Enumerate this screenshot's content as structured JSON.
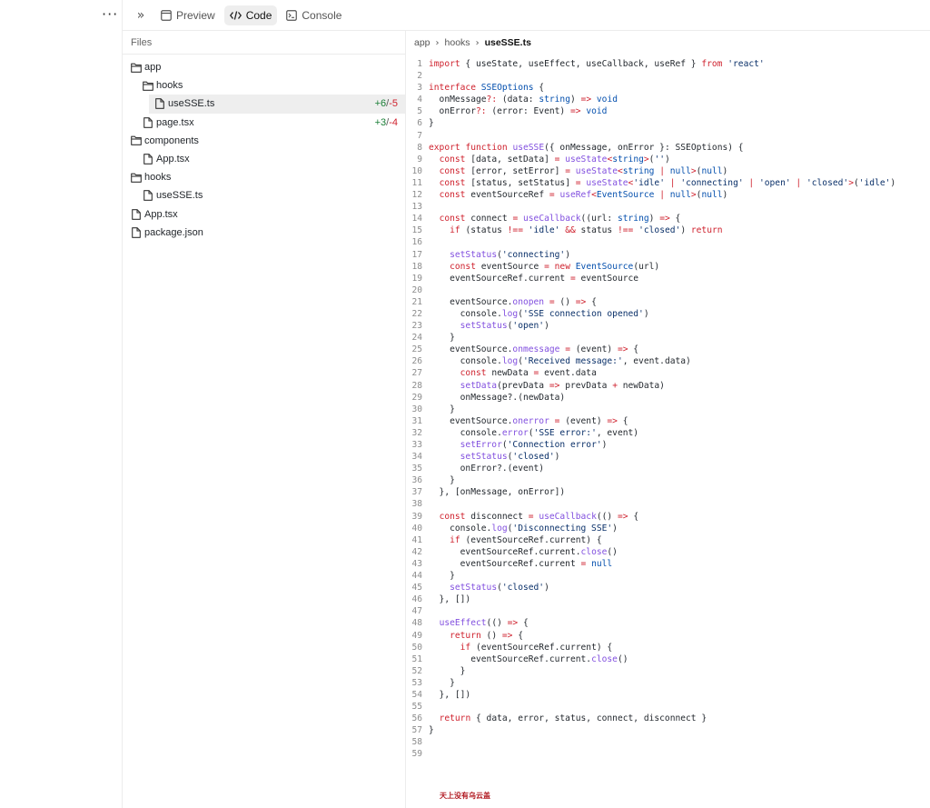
{
  "toolbar": {
    "more_label": "···",
    "collapse_label": "»",
    "tabs": [
      {
        "label": "Preview",
        "icon": "window-icon"
      },
      {
        "label": "Code",
        "icon": "code-icon"
      },
      {
        "label": "Console",
        "icon": "terminal-icon"
      }
    ],
    "active_tab": "Code"
  },
  "sidebar": {
    "title": "Files",
    "items": [
      {
        "label": "app",
        "type": "folder",
        "depth": 0
      },
      {
        "label": "hooks",
        "type": "folder",
        "depth": 1
      },
      {
        "label": "useSSE.ts",
        "type": "file",
        "depth": 2,
        "selected": true,
        "added": "+6",
        "removed": "-5"
      },
      {
        "label": "page.tsx",
        "type": "file",
        "depth": 1,
        "added": "+3",
        "removed": "-4"
      },
      {
        "label": "components",
        "type": "folder",
        "depth": 0
      },
      {
        "label": "App.tsx",
        "type": "file",
        "depth": 1
      },
      {
        "label": "hooks",
        "type": "folder",
        "depth": 0
      },
      {
        "label": "useSSE.ts",
        "type": "file",
        "depth": 1
      },
      {
        "label": "App.tsx",
        "type": "file",
        "depth": 0
      },
      {
        "label": "package.json",
        "type": "file",
        "depth": 0
      }
    ]
  },
  "editor": {
    "breadcrumb": [
      "app",
      "hooks",
      "useSSE.ts"
    ],
    "lines": [
      [
        [
          "k",
          "import"
        ],
        [
          "p",
          " { useState, useEffect, useCallback, useRef } "
        ],
        [
          "k",
          "from"
        ],
        [
          "p",
          " "
        ],
        [
          "s",
          "'react'"
        ]
      ],
      [],
      [
        [
          "k",
          "interface"
        ],
        [
          "p",
          " "
        ],
        [
          "t",
          "SSEOptions"
        ],
        [
          "p",
          " {"
        ]
      ],
      [
        [
          "p",
          "  onMessage"
        ],
        [
          "k",
          "?:"
        ],
        [
          "p",
          " (data: "
        ],
        [
          "t",
          "string"
        ],
        [
          "p",
          ") "
        ],
        [
          "k",
          "=>"
        ],
        [
          "p",
          " "
        ],
        [
          "t",
          "void"
        ]
      ],
      [
        [
          "p",
          "  onError"
        ],
        [
          "k",
          "?:"
        ],
        [
          "p",
          " (error: Event) "
        ],
        [
          "k",
          "=>"
        ],
        [
          "p",
          " "
        ],
        [
          "t",
          "void"
        ]
      ],
      [
        [
          "p",
          "}"
        ]
      ],
      [],
      [
        [
          "k",
          "export"
        ],
        [
          "p",
          " "
        ],
        [
          "k",
          "function"
        ],
        [
          "p",
          " "
        ],
        [
          "f",
          "useSSE"
        ],
        [
          "p",
          "({ onMessage, onError }: SSEOptions) {"
        ]
      ],
      [
        [
          "p",
          "  "
        ],
        [
          "k",
          "const"
        ],
        [
          "p",
          " [data, setData] "
        ],
        [
          "k",
          "="
        ],
        [
          "p",
          " "
        ],
        [
          "f",
          "useState"
        ],
        [
          "k",
          "<"
        ],
        [
          "t",
          "string"
        ],
        [
          "k",
          ">"
        ],
        [
          "p",
          "("
        ],
        [
          "s",
          "''"
        ],
        [
          "p",
          ")"
        ]
      ],
      [
        [
          "p",
          "  "
        ],
        [
          "k",
          "const"
        ],
        [
          "p",
          " [error, setError] "
        ],
        [
          "k",
          "="
        ],
        [
          "p",
          " "
        ],
        [
          "f",
          "useState"
        ],
        [
          "k",
          "<"
        ],
        [
          "t",
          "string"
        ],
        [
          "p",
          " "
        ],
        [
          "k",
          "|"
        ],
        [
          "p",
          " "
        ],
        [
          "t",
          "null"
        ],
        [
          "k",
          ">"
        ],
        [
          "p",
          "("
        ],
        [
          "t",
          "null"
        ],
        [
          "p",
          ")"
        ]
      ],
      [
        [
          "p",
          "  "
        ],
        [
          "k",
          "const"
        ],
        [
          "p",
          " [status, setStatus] "
        ],
        [
          "k",
          "="
        ],
        [
          "p",
          " "
        ],
        [
          "f",
          "useState"
        ],
        [
          "k",
          "<"
        ],
        [
          "s",
          "'idle'"
        ],
        [
          "p",
          " "
        ],
        [
          "k",
          "|"
        ],
        [
          "p",
          " "
        ],
        [
          "s",
          "'connecting'"
        ],
        [
          "p",
          " "
        ],
        [
          "k",
          "|"
        ],
        [
          "p",
          " "
        ],
        [
          "s",
          "'open'"
        ],
        [
          "p",
          " "
        ],
        [
          "k",
          "|"
        ],
        [
          "p",
          " "
        ],
        [
          "s",
          "'closed'"
        ],
        [
          "k",
          ">"
        ],
        [
          "p",
          "("
        ],
        [
          "s",
          "'idle'"
        ],
        [
          "p",
          ")"
        ]
      ],
      [
        [
          "p",
          "  "
        ],
        [
          "k",
          "const"
        ],
        [
          "p",
          " eventSourceRef "
        ],
        [
          "k",
          "="
        ],
        [
          "p",
          " "
        ],
        [
          "f",
          "useRef"
        ],
        [
          "k",
          "<"
        ],
        [
          "t",
          "EventSource"
        ],
        [
          "p",
          " "
        ],
        [
          "k",
          "|"
        ],
        [
          "p",
          " "
        ],
        [
          "t",
          "null"
        ],
        [
          "k",
          ">"
        ],
        [
          "p",
          "("
        ],
        [
          "t",
          "null"
        ],
        [
          "p",
          ")"
        ]
      ],
      [],
      [
        [
          "p",
          "  "
        ],
        [
          "k",
          "const"
        ],
        [
          "p",
          " connect "
        ],
        [
          "k",
          "="
        ],
        [
          "p",
          " "
        ],
        [
          "f",
          "useCallback"
        ],
        [
          "p",
          "((url: "
        ],
        [
          "t",
          "string"
        ],
        [
          "p",
          ") "
        ],
        [
          "k",
          "=>"
        ],
        [
          "p",
          " {"
        ]
      ],
      [
        [
          "p",
          "    "
        ],
        [
          "k",
          "if"
        ],
        [
          "p",
          " (status "
        ],
        [
          "k",
          "!=="
        ],
        [
          "p",
          " "
        ],
        [
          "s",
          "'idle'"
        ],
        [
          "p",
          " "
        ],
        [
          "k",
          "&&"
        ],
        [
          "p",
          " status "
        ],
        [
          "k",
          "!=="
        ],
        [
          "p",
          " "
        ],
        [
          "s",
          "'closed'"
        ],
        [
          "p",
          ") "
        ],
        [
          "k",
          "return"
        ]
      ],
      [],
      [
        [
          "p",
          "    "
        ],
        [
          "f",
          "setStatus"
        ],
        [
          "p",
          "("
        ],
        [
          "s",
          "'connecting'"
        ],
        [
          "p",
          ")"
        ]
      ],
      [
        [
          "p",
          "    "
        ],
        [
          "k",
          "const"
        ],
        [
          "p",
          " eventSource "
        ],
        [
          "k",
          "="
        ],
        [
          "p",
          " "
        ],
        [
          "k",
          "new"
        ],
        [
          "p",
          " "
        ],
        [
          "t",
          "EventSource"
        ],
        [
          "p",
          "(url)"
        ]
      ],
      [
        [
          "p",
          "    eventSourceRef.current "
        ],
        [
          "k",
          "="
        ],
        [
          "p",
          " eventSource"
        ]
      ],
      [],
      [
        [
          "p",
          "    eventSource."
        ],
        [
          "f",
          "onopen"
        ],
        [
          "p",
          " "
        ],
        [
          "k",
          "="
        ],
        [
          "p",
          " () "
        ],
        [
          "k",
          "=>"
        ],
        [
          "p",
          " {"
        ]
      ],
      [
        [
          "p",
          "      console."
        ],
        [
          "f",
          "log"
        ],
        [
          "p",
          "("
        ],
        [
          "s",
          "'SSE connection opened'"
        ],
        [
          "p",
          ")"
        ]
      ],
      [
        [
          "p",
          "      "
        ],
        [
          "f",
          "setStatus"
        ],
        [
          "p",
          "("
        ],
        [
          "s",
          "'open'"
        ],
        [
          "p",
          ")"
        ]
      ],
      [
        [
          "p",
          "    }"
        ]
      ],
      [
        [
          "p",
          "    eventSource."
        ],
        [
          "f",
          "onmessage"
        ],
        [
          "p",
          " "
        ],
        [
          "k",
          "="
        ],
        [
          "p",
          " (event) "
        ],
        [
          "k",
          "=>"
        ],
        [
          "p",
          " {"
        ]
      ],
      [
        [
          "p",
          "      console."
        ],
        [
          "f",
          "log"
        ],
        [
          "p",
          "("
        ],
        [
          "s",
          "'Received message:'"
        ],
        [
          "p",
          ", event.data)"
        ]
      ],
      [
        [
          "p",
          "      "
        ],
        [
          "k",
          "const"
        ],
        [
          "p",
          " newData "
        ],
        [
          "k",
          "="
        ],
        [
          "p",
          " event.data"
        ]
      ],
      [
        [
          "p",
          "      "
        ],
        [
          "f",
          "setData"
        ],
        [
          "p",
          "(prevData "
        ],
        [
          "k",
          "=>"
        ],
        [
          "p",
          " prevData "
        ],
        [
          "k",
          "+"
        ],
        [
          "p",
          " newData)"
        ]
      ],
      [
        [
          "p",
          "      onMessage?.(newData)"
        ]
      ],
      [
        [
          "p",
          "    }"
        ]
      ],
      [
        [
          "p",
          "    eventSource."
        ],
        [
          "f",
          "onerror"
        ],
        [
          "p",
          " "
        ],
        [
          "k",
          "="
        ],
        [
          "p",
          " (event) "
        ],
        [
          "k",
          "=>"
        ],
        [
          "p",
          " {"
        ]
      ],
      [
        [
          "p",
          "      console."
        ],
        [
          "f",
          "error"
        ],
        [
          "p",
          "("
        ],
        [
          "s",
          "'SSE error:'"
        ],
        [
          "p",
          ", event)"
        ]
      ],
      [
        [
          "p",
          "      "
        ],
        [
          "f",
          "setError"
        ],
        [
          "p",
          "("
        ],
        [
          "s",
          "'Connection error'"
        ],
        [
          "p",
          ")"
        ]
      ],
      [
        [
          "p",
          "      "
        ],
        [
          "f",
          "setStatus"
        ],
        [
          "p",
          "("
        ],
        [
          "s",
          "'closed'"
        ],
        [
          "p",
          ")"
        ]
      ],
      [
        [
          "p",
          "      onError?.(event)"
        ]
      ],
      [
        [
          "p",
          "    }"
        ]
      ],
      [
        [
          "p",
          "  }, [onMessage, onError])"
        ]
      ],
      [],
      [
        [
          "p",
          "  "
        ],
        [
          "k",
          "const"
        ],
        [
          "p",
          " disconnect "
        ],
        [
          "k",
          "="
        ],
        [
          "p",
          " "
        ],
        [
          "f",
          "useCallback"
        ],
        [
          "p",
          "(() "
        ],
        [
          "k",
          "=>"
        ],
        [
          "p",
          " {"
        ]
      ],
      [
        [
          "p",
          "    console."
        ],
        [
          "f",
          "log"
        ],
        [
          "p",
          "("
        ],
        [
          "s",
          "'Disconnecting SSE'"
        ],
        [
          "p",
          ")"
        ]
      ],
      [
        [
          "p",
          "    "
        ],
        [
          "k",
          "if"
        ],
        [
          "p",
          " (eventSourceRef.current) {"
        ]
      ],
      [
        [
          "p",
          "      eventSourceRef.current."
        ],
        [
          "f",
          "close"
        ],
        [
          "p",
          "()"
        ]
      ],
      [
        [
          "p",
          "      eventSourceRef.current "
        ],
        [
          "k",
          "="
        ],
        [
          "p",
          " "
        ],
        [
          "t",
          "null"
        ]
      ],
      [
        [
          "p",
          "    }"
        ]
      ],
      [
        [
          "p",
          "    "
        ],
        [
          "f",
          "setStatus"
        ],
        [
          "p",
          "("
        ],
        [
          "s",
          "'closed'"
        ],
        [
          "p",
          ")"
        ]
      ],
      [
        [
          "p",
          "  }, [])"
        ]
      ],
      [],
      [
        [
          "p",
          "  "
        ],
        [
          "f",
          "useEffect"
        ],
        [
          "p",
          "(() "
        ],
        [
          "k",
          "=>"
        ],
        [
          "p",
          " {"
        ]
      ],
      [
        [
          "p",
          "    "
        ],
        [
          "k",
          "return"
        ],
        [
          "p",
          " () "
        ],
        [
          "k",
          "=>"
        ],
        [
          "p",
          " {"
        ]
      ],
      [
        [
          "p",
          "      "
        ],
        [
          "k",
          "if"
        ],
        [
          "p",
          " (eventSourceRef.current) {"
        ]
      ],
      [
        [
          "p",
          "        eventSourceRef.current."
        ],
        [
          "f",
          "close"
        ],
        [
          "p",
          "()"
        ]
      ],
      [
        [
          "p",
          "      }"
        ]
      ],
      [
        [
          "p",
          "    }"
        ]
      ],
      [
        [
          "p",
          "  }, [])"
        ]
      ],
      [],
      [
        [
          "p",
          "  "
        ],
        [
          "k",
          "return"
        ],
        [
          "p",
          " { data, error, status, connect, disconnect }"
        ]
      ],
      [
        [
          "p",
          "}"
        ]
      ],
      [],
      []
    ]
  },
  "watermark": "天上没有乌云盖",
  "colors": {
    "keyword": "#cf222e",
    "function": "#8250df",
    "string": "#0a3069",
    "type": "#0550ae",
    "diff_add": "#1a7f37",
    "diff_del": "#cf222e"
  }
}
